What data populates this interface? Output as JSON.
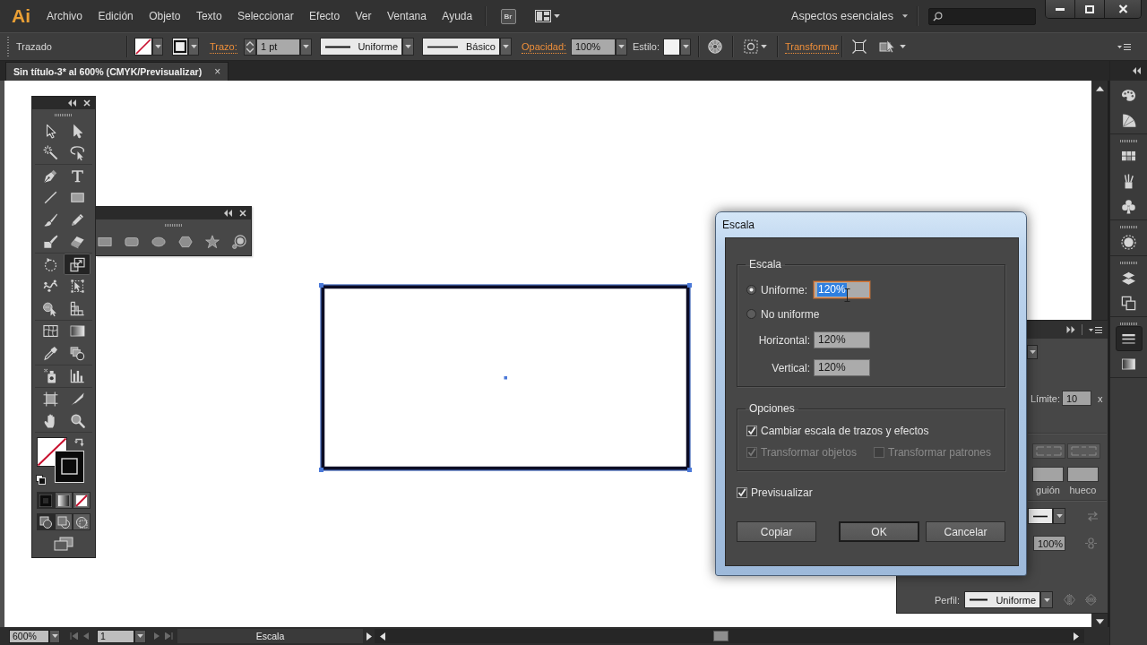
{
  "menu_bar": {
    "logo": "Ai",
    "menus": [
      "Archivo",
      "Edición",
      "Objeto",
      "Texto",
      "Seleccionar",
      "Efecto",
      "Ver",
      "Ventana",
      "Ayuda"
    ],
    "bridge_button": "Br",
    "workspace": "Aspectos esenciales"
  },
  "control_bar": {
    "selection_type": "Trazado",
    "stroke_label": "Trazo:",
    "stroke_weight": "1 pt",
    "width_profile": "Uniforme",
    "brush": "Básico",
    "opacity_label": "Opacidad:",
    "opacity": "100%",
    "style_label": "Estilo:",
    "transform_link": "Transformar"
  },
  "document_tab": {
    "title": "Sin título-3* al 600% (CMYK/Previsualizar)",
    "close": "×"
  },
  "tools_panel": {
    "groups": [
      {
        "tools": [
          {
            "kind": "selection",
            "selected": false
          },
          {
            "kind": "direct-selection",
            "selected": false
          },
          {
            "kind": "magic-wand",
            "selected": false
          },
          {
            "kind": "lasso",
            "selected": false
          }
        ]
      },
      {
        "tools": [
          {
            "kind": "pen",
            "selected": false
          },
          {
            "kind": "type",
            "selected": false
          },
          {
            "kind": "line",
            "selected": false
          },
          {
            "kind": "rectangle",
            "selected": false
          },
          {
            "kind": "paintbrush",
            "selected": false
          },
          {
            "kind": "pencil",
            "selected": false
          },
          {
            "kind": "blob-brush",
            "selected": false
          },
          {
            "kind": "eraser",
            "selected": false
          }
        ]
      },
      {
        "tools": [
          {
            "kind": "rotate",
            "selected": false
          },
          {
            "kind": "scale",
            "selected": true
          },
          {
            "kind": "warp",
            "selected": false
          },
          {
            "kind": "free-transform",
            "selected": false
          },
          {
            "kind": "shape-builder",
            "selected": false
          },
          {
            "kind": "perspective-grid",
            "selected": false
          }
        ]
      },
      {
        "tools": [
          {
            "kind": "mesh",
            "selected": false
          },
          {
            "kind": "gradient",
            "selected": false
          },
          {
            "kind": "eyedropper",
            "selected": false
          },
          {
            "kind": "blend",
            "selected": false
          }
        ]
      },
      {
        "tools": [
          {
            "kind": "symbol-sprayer",
            "selected": false
          },
          {
            "kind": "graph",
            "selected": false
          }
        ]
      },
      {
        "tools": [
          {
            "kind": "artboard",
            "selected": false
          },
          {
            "kind": "slice",
            "selected": false
          },
          {
            "kind": "hand",
            "selected": false
          },
          {
            "kind": "zoom",
            "selected": false
          }
        ]
      }
    ],
    "fill_modes": [
      {
        "kind": "color",
        "selected": true
      },
      {
        "kind": "gradient",
        "selected": false
      },
      {
        "kind": "none",
        "selected": false
      }
    ],
    "draw_modes": [
      {
        "kind": "normal",
        "selected": true
      },
      {
        "kind": "behind",
        "selected": false
      },
      {
        "kind": "inside",
        "selected": false
      }
    ]
  },
  "shapes_flyout": {
    "tools": [
      {
        "kind": "rectangle"
      },
      {
        "kind": "rounded-rectangle"
      },
      {
        "kind": "ellipse"
      },
      {
        "kind": "polygon"
      },
      {
        "kind": "star"
      },
      {
        "kind": "flare"
      }
    ]
  },
  "scale_dialog": {
    "title": "Escala",
    "scale_group": {
      "legend": "Escala",
      "modes": [
        {
          "label": "Uniforme:",
          "selected": true,
          "value": "120%",
          "focused": true
        },
        {
          "label": "No uniforme",
          "selected": false
        }
      ],
      "axes": [
        {
          "label": "Horizontal:",
          "value": "120%"
        },
        {
          "label": "Vertical:",
          "value": "120%"
        }
      ]
    },
    "options_group": {
      "legend": "Opciones",
      "checkboxes": [
        {
          "label": "Cambiar escala de trazos y efectos",
          "checked": true,
          "disabled": false
        },
        {
          "label": "Transformar objetos",
          "checked": true,
          "disabled": true
        },
        {
          "label": "Transformar patrones",
          "checked": false,
          "disabled": true
        }
      ]
    },
    "preview": {
      "label": "Previsualizar",
      "checked": true
    },
    "buttons": [
      {
        "label": "Copiar",
        "default": false
      },
      {
        "label": "OK",
        "default": true
      },
      {
        "label": "Cancelar",
        "default": false
      }
    ]
  },
  "stroke_panel": {
    "miter_label": "Límite:",
    "miter_value": "10",
    "miter_unit": "x",
    "dash_labels": [
      "guión",
      "hueco"
    ],
    "arrowhead_scale": "100%",
    "profile_label": "Perfil:",
    "profile": "Uniforme"
  },
  "dock": {
    "groups": [
      {
        "panels": [
          {
            "kind": "color",
            "selected": false
          },
          {
            "kind": "color-guide",
            "selected": false
          }
        ]
      },
      {
        "panels": [
          {
            "kind": "swatches",
            "selected": false
          },
          {
            "kind": "brushes",
            "selected": false
          },
          {
            "kind": "symbols",
            "selected": false
          }
        ]
      },
      {
        "panels": [
          {
            "kind": "graphic-styles",
            "selected": false
          }
        ]
      },
      {
        "panels": [
          {
            "kind": "layers",
            "selected": false
          },
          {
            "kind": "artboards",
            "selected": false
          }
        ]
      },
      {
        "panels": [
          {
            "kind": "stroke",
            "selected": true
          },
          {
            "kind": "gradient",
            "selected": false
          }
        ]
      }
    ]
  },
  "status_bar": {
    "zoom": "600%",
    "artboard": "1",
    "current_tool": "Escala"
  }
}
